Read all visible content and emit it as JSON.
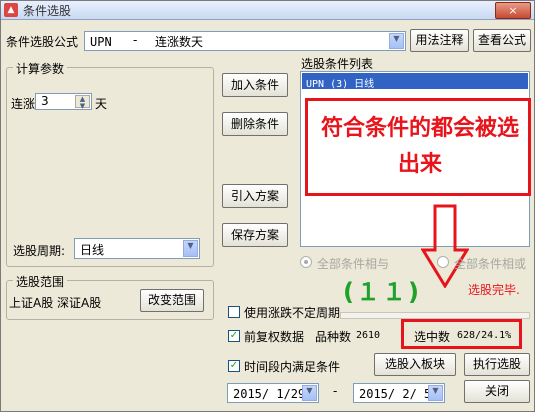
{
  "window": {
    "title": "条件选股",
    "close_label": "×"
  },
  "formula": {
    "label": "条件选股公式",
    "code": "UPN",
    "dash": "-",
    "name": "连涨数天",
    "usage_button": "用法注释",
    "view_button": "查看公式"
  },
  "params": {
    "group_label": "计算参数",
    "prefix": "连涨",
    "value": "3",
    "suffix": "天",
    "period_label": "选股周期:",
    "period_value": "日线"
  },
  "scope": {
    "group_label": "选股范围",
    "markets": "上证A股 深证A股",
    "change_button": "改变范围"
  },
  "actions": {
    "add": "加入条件",
    "delete": "删除条件",
    "import": "引入方案",
    "save": "保存方案"
  },
  "condition_list": {
    "label": "选股条件列表",
    "items": [
      "UPN (3) 日线"
    ]
  },
  "annotation": {
    "callout_text": "符合条件的都会被选出来",
    "count_overlay": "(１１)",
    "status_text": "选股完毕.",
    "color_red": "#e8141c",
    "color_green": "#1fa12b"
  },
  "logic": {
    "and_label": "全部条件相与",
    "or_label": "全部条件相或"
  },
  "options": {
    "uncertain_period": "使用涨跌不定周期",
    "forward_adjust": "前复权数据",
    "time_range": "时间段内满足条件"
  },
  "stats": {
    "count_label": "品种数",
    "count_value": "2610",
    "selected_label": "选中数",
    "selected_value": "628/24.1%"
  },
  "date_range": {
    "start": "2015/ 1/29",
    "separator": "-",
    "end": "2015/ 2/ 5"
  },
  "buttons": {
    "to_sector": "选股入板块",
    "execute": "执行选股",
    "close": "关闭"
  }
}
